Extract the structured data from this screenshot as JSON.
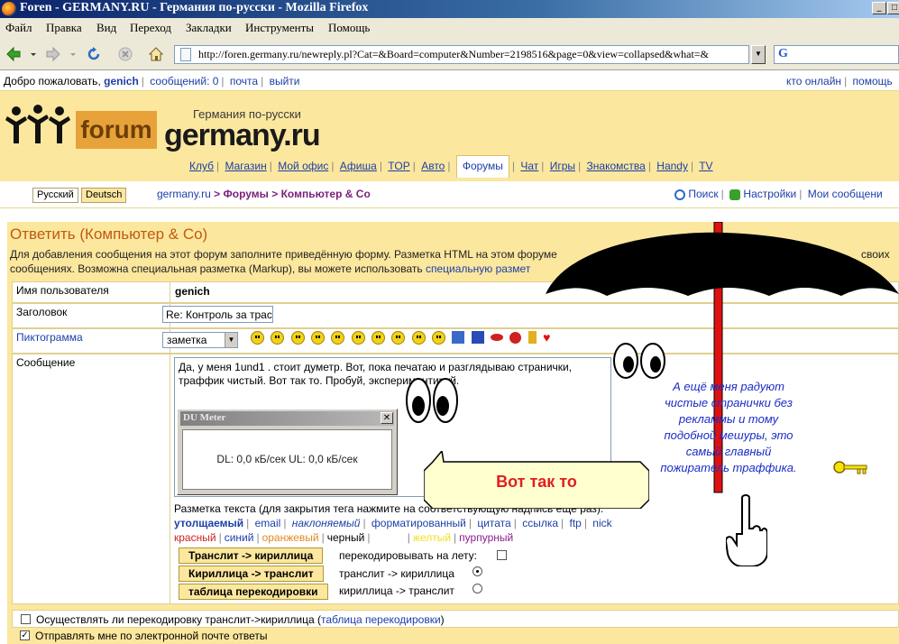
{
  "window": {
    "title": "Foren - GERMANY.RU - Германия по-русски - Mozilla Firefox"
  },
  "menu": [
    "Файл",
    "Правка",
    "Вид",
    "Переход",
    "Закладки",
    "Инструменты",
    "Помощь"
  ],
  "address": {
    "url": "http://foren.germany.ru/newreply.pl?Cat=&Board=computer&Number=2198516&page=0&view=collapsed&what=&"
  },
  "search": {
    "logo": "G"
  },
  "top_strip": {
    "welcome": "Добро пожаловать,",
    "user": "genich",
    "messages": "сообщений: 0",
    "mail": "почта",
    "logout": "выйти",
    "online": "кто онлайн",
    "help": "помощь"
  },
  "header": {
    "forum_word": "forum",
    "subtitle": "Германия по-русски",
    "site_name": "germany.ru",
    "nav": [
      "Клуб",
      "Магазин",
      "Мой офис",
      "Афиша",
      "TOP",
      "Авто",
      "Форумы",
      "Чат",
      "Игры",
      "Знакомства",
      "Handy",
      "TV"
    ],
    "active_nav": "Форумы"
  },
  "crumbbar": {
    "lang_ru": "Русский",
    "lang_de": "Deutsch",
    "crumb_site": "germany.ru",
    "crumb_sep": ">",
    "crumb_forums": "Форумы",
    "crumb_board": "Компьютер & Co",
    "search": "Поиск",
    "settings": "Настройки",
    "my_messages": "Мои сообщени"
  },
  "form": {
    "heading": "Ответить (Компьютер & Co)",
    "intro_line1": "Для добавления сообщения на этот форум заполните приведённую форму. Разметка HTML на этом форуме",
    "intro_line1_end": "своих",
    "intro_line2": "сообщениях. Возможна специальная разметка (Markup), вы можете использовать",
    "intro_link": "специальную размет",
    "username_label": "Имя пользователя",
    "username": "genich",
    "subject_label": "Заголовок",
    "subject_value": "Re: Контроль за трас",
    "icon_label": "Пиктограмма",
    "icon_select": "заметка",
    "message_label": "Сообщение",
    "message_line1": "Да, у меня 1und1 . стоит думетр. Вот, пока печатаю и разглядываю странички,",
    "message_line2": "траффик  чистый. Вот так то. Пробуй, экспериментируй.",
    "markup_hint": "Разметка текста (для закрытия тега нажмите на соответствующую надпись ещё раз):",
    "markup_tags": [
      "утолщаемый",
      "email",
      "наклоняемый",
      "форматированный",
      "цитата",
      "ссылка",
      "ftp",
      "nick"
    ],
    "colors": [
      {
        "label": "красный",
        "color": "#d02020"
      },
      {
        "label": "синий",
        "color": "#1c3fa8"
      },
      {
        "label": "оранжевый",
        "color": "#e08a1c"
      },
      {
        "label": "черный",
        "color": "#000000"
      },
      {
        "label": "белый",
        "color": "#ffffff"
      },
      {
        "label": "желтый",
        "color": "#f0e020"
      },
      {
        "label": "пурпурный",
        "color": "#8a1f8a"
      }
    ],
    "btn_translit": "Транслит -> кириллица",
    "btn_cyr": "Кириллица -> транслит",
    "btn_table": "таблица перекодировки",
    "opt_onfly": "перекодировывать на лету:",
    "opt_t2c": "транслит -> кириллица",
    "opt_c2t": "кириллица -> транслит",
    "chk_recode": "Осуществлять ли перекодировку транслит->кириллица (",
    "chk_recode_link": "таблица перекодировки",
    "chk_recode_end": ")",
    "chk_email": "Отправлять мне по электронной почте ответы"
  },
  "du_meter": {
    "title": "DU Meter",
    "readout": "DL: 0,0 кБ/сек  UL: 0,0 кБ/сек"
  },
  "overlays": {
    "speech": "Вот так то",
    "note_line1": "А ещё меня радуют",
    "note_line2": "чистые странички без",
    "note_line3": "рекламмы и тому",
    "note_line4": "подобной мешуры, это",
    "note_line5": "самый главный",
    "note_line6": "пожиратель траффика."
  },
  "colors": {
    "header_bg": "#fce79e",
    "heading": "#c05a14",
    "link": "#1c3fa8",
    "umbrella": "#000000",
    "umbrella_pole": "#e01010",
    "note_text": "#1a2cc8"
  }
}
